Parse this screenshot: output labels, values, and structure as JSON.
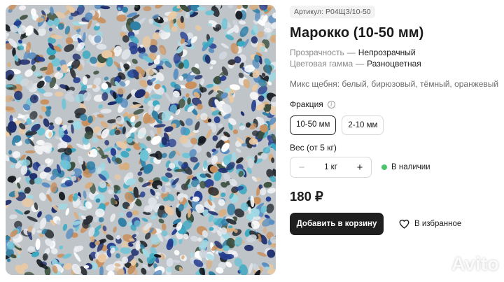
{
  "product": {
    "sku": "Артикул: Р04ЩЗ/10-50",
    "title": "Марокко (10-50 мм)",
    "properties": [
      {
        "key": "Прозрачность",
        "value": "Непрозрачный"
      },
      {
        "key": "Цветовая гамма",
        "value": "Разноцветная"
      }
    ],
    "description": "Микс щебня: белый, бирюзовый, тёмный, оранжевый",
    "image_icon": "gravel-photo"
  },
  "fraction": {
    "label": "Фракция",
    "info_icon": "info-icon",
    "options": [
      "10-50 мм",
      "2-10 мм"
    ],
    "selected": "10-50 мм"
  },
  "weight": {
    "label": "Вес (от 5 кг)",
    "minus": "−",
    "plus": "+",
    "value": "1 кг"
  },
  "stock": {
    "text": "В наличии",
    "color": "#4cc46e"
  },
  "price": "180 ₽",
  "actions": {
    "add_to_cart": "Добавить в корзину",
    "favorite": "В избранное",
    "favorite_icon": "heart-icon"
  },
  "watermark": "Avito",
  "colors": {
    "primary_button": "#1f1f1f",
    "muted_text": "#8a8a8a"
  }
}
